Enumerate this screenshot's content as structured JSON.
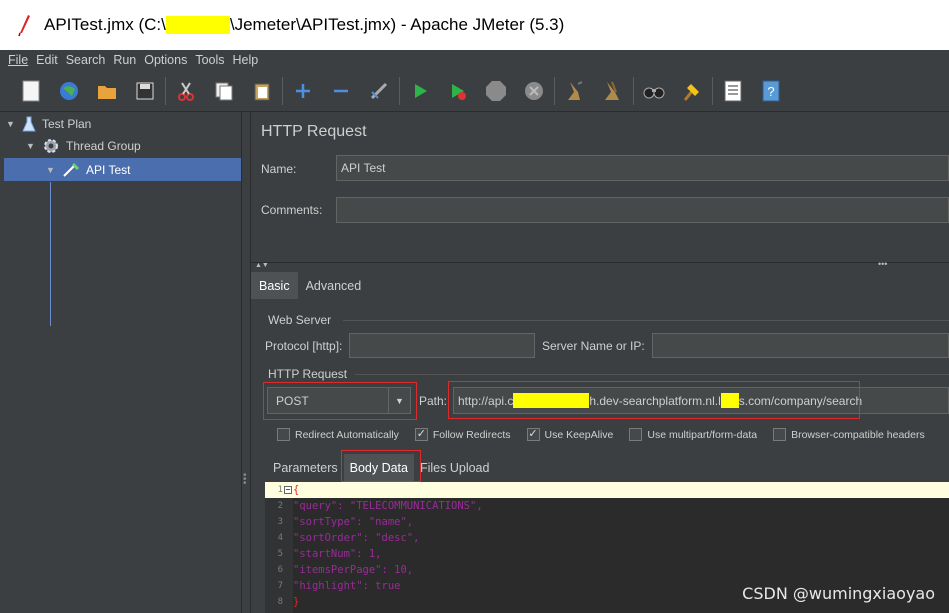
{
  "window": {
    "title_prefix": "APITest.jmx (C:\\",
    "title_suffix": "\\Jemeter\\APITest.jmx) - Apache JMeter (5.3)"
  },
  "menu": [
    "File",
    "Edit",
    "Search",
    "Run",
    "Options",
    "Tools",
    "Help"
  ],
  "toolbar": {
    "icons": [
      "new-icon",
      "templates-icon",
      "open-icon",
      "save-icon",
      "cut-icon",
      "copy-icon",
      "paste-icon",
      "expand-icon",
      "collapse-icon",
      "toggle-icon",
      "start-icon",
      "start-no-pause-icon",
      "stop-icon",
      "shutdown-icon",
      "clear-icon",
      "clear-all-icon",
      "search-icon",
      "reset-search-icon",
      "function-helper-icon",
      "help-icon"
    ]
  },
  "tree": {
    "test_plan": "Test Plan",
    "thread_group": "Thread Group",
    "api_test": "API Test"
  },
  "panel": {
    "title": "HTTP Request",
    "name_label": "Name:",
    "name_value": "API Test",
    "comments_label": "Comments:",
    "tabs": [
      "Basic",
      "Advanced"
    ],
    "web_server": "Web Server",
    "protocol_label": "Protocol [http]:",
    "server_label": "Server Name or IP:",
    "http_request_group": "HTTP Request",
    "method": "POST",
    "path_label": "Path:",
    "path_prefix": "http://api.c",
    "path_middle": "h.dev-searchplatform.nl.l",
    "path_suffix": "s.com/company/search",
    "checkboxes": [
      {
        "label": "Redirect Automatically",
        "checked": false
      },
      {
        "label": "Follow Redirects",
        "checked": true
      },
      {
        "label": "Use KeepAlive",
        "checked": true
      },
      {
        "label": "Use multipart/form-data",
        "checked": false
      },
      {
        "label": "Browser-compatible headers",
        "checked": false
      }
    ],
    "subtabs": [
      "Parameters",
      "Body Data",
      "Files Upload"
    ]
  },
  "body_data": {
    "line_numbers": [
      "1",
      "2",
      "3",
      "4",
      "5",
      "6",
      "7",
      "8"
    ],
    "lines": [
      "{",
      "\"query\": \"TELECOMMUNICATIONS\",",
      "\"sortType\": \"name\",",
      "\"sortOrder\": \"desc\",",
      "\"startNum\": 1,",
      "\"itemsPerPage\": 10,",
      "\"highlight\": true",
      "}"
    ]
  },
  "watermark": "CSDN @wumingxiaoyao",
  "colors": {
    "highlight_line": "#ffffe0",
    "redact": "#ffff00",
    "annotation_red": "#e0292b",
    "selected": "#4b6eaf"
  }
}
